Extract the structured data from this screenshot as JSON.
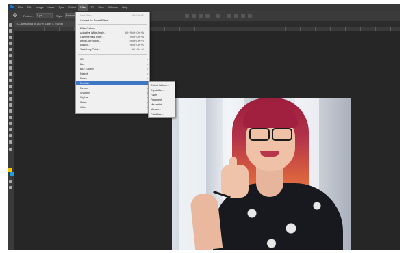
{
  "menubar": {
    "logo": "Ps",
    "items": [
      "File",
      "Edit",
      "Image",
      "Layer",
      "Type",
      "Select",
      "Filter",
      "3D",
      "View",
      "Window",
      "Help"
    ],
    "active_index": 6
  },
  "options": {
    "feather_label": "Feather:",
    "feather_value": "0 px",
    "style_label": "Style:",
    "style_value": "Normal"
  },
  "document": {
    "tab_title": "TC-Alessandra @ 16.7% (Layer 0, RGB/8)"
  },
  "filter_menu": {
    "items": [
      {
        "label": "Last Filter",
        "shortcut": "Alt+Ctrl+F",
        "disabled": true
      },
      {
        "label": "Convert for Smart Filters"
      },
      {
        "sep": true
      },
      {
        "label": "Filter Gallery..."
      },
      {
        "label": "Adaptive Wide Angle...",
        "shortcut": "Alt+Shift+Ctrl+A"
      },
      {
        "label": "Camera Raw Filter...",
        "shortcut": "Shift+Ctrl+A"
      },
      {
        "label": "Lens Correction...",
        "shortcut": "Shift+Ctrl+R"
      },
      {
        "label": "Liquify...",
        "shortcut": "Shift+Ctrl+X"
      },
      {
        "label": "Vanishing Point...",
        "shortcut": "Alt+Ctrl+V"
      },
      {
        "sep": true
      },
      {
        "label": "3D",
        "submenu": true
      },
      {
        "label": "Blur",
        "submenu": true
      },
      {
        "label": "Blur Gallery",
        "submenu": true
      },
      {
        "label": "Distort",
        "submenu": true
      },
      {
        "label": "Noise",
        "submenu": true
      },
      {
        "label": "Pixelate",
        "submenu": true,
        "highlighted": true
      },
      {
        "label": "Render",
        "submenu": true
      },
      {
        "label": "Sharpen",
        "submenu": true
      },
      {
        "label": "Stylize",
        "submenu": true
      },
      {
        "label": "Video",
        "submenu": true
      },
      {
        "label": "Other",
        "submenu": true
      }
    ]
  },
  "pixelate_submenu": {
    "items": [
      "Color Halftone...",
      "Crystallize...",
      "Facet",
      "Fragment",
      "Mezzotint...",
      "Mosaic...",
      "Pointillize..."
    ]
  },
  "colors": {
    "app_bg": "#222222",
    "menu_bg": "#f0f0f0",
    "highlight": "#3f77c4",
    "foreground_swatch": "#f5c400",
    "background_swatch": "#1fa0d8",
    "hair_top": "#9c1d3c",
    "hair_tip": "#f08a4b"
  },
  "icons": {
    "tool_preset": "move-tool-icon",
    "tools": [
      "move-icon",
      "marquee-icon",
      "lasso-icon",
      "quick-select-icon",
      "crop-icon",
      "eyedropper-icon",
      "healing-icon",
      "brush-icon",
      "stamp-icon",
      "history-brush-icon",
      "eraser-icon",
      "gradient-icon",
      "blur-icon",
      "dodge-icon",
      "pen-icon",
      "type-icon",
      "path-select-icon",
      "shape-icon",
      "hand-icon",
      "zoom-icon"
    ]
  }
}
